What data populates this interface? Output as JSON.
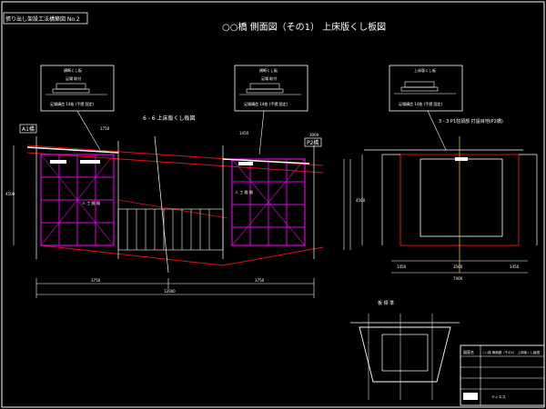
{
  "sheet": {
    "header_label": "張り出し架設工法構築図 No.2",
    "title": "○○橋 側面図（その1） 上床版くし板図"
  },
  "callouts": {
    "left_top": "横断くし板",
    "left_sub": "足場 取付",
    "left_caption": "足場構造 14枚 (手摺 固定)",
    "mid_top": "横断くし板",
    "mid_sub": "足場 取付",
    "mid_caption": "足場構造 14枚 (手摺 固定)",
    "right_top": "上床版くし板",
    "right_caption": "足場構造 14枚 (手摺 固定)"
  },
  "side_view": {
    "section_label": "6 - 6 上床版くし板図",
    "a1_label": "A1橋",
    "p2_label": "P2橋",
    "dim_left": "1750",
    "dim_mid": "1450",
    "dim_right": "3000",
    "dim_bottom_left": "3750",
    "dim_bottom_right": "3750",
    "dim_total": "12000",
    "note_left": "人 工 間 隔",
    "note_right": "人 工 間 隔",
    "depth_dim": "4500"
  },
  "section_view": {
    "label": "3 - 3 P1柱頭部 打設目地(P2橋)",
    "dims": [
      "1450",
      "3500",
      "1450"
    ],
    "total": "7400",
    "side_dim": "4500"
  },
  "plan_view": {
    "label": "板 標 準"
  },
  "title_block": {
    "rows": [
      "図面名",
      "○○橋 側面図（その1） 上床版くし板図",
      "",
      "",
      "ティエス"
    ]
  }
}
